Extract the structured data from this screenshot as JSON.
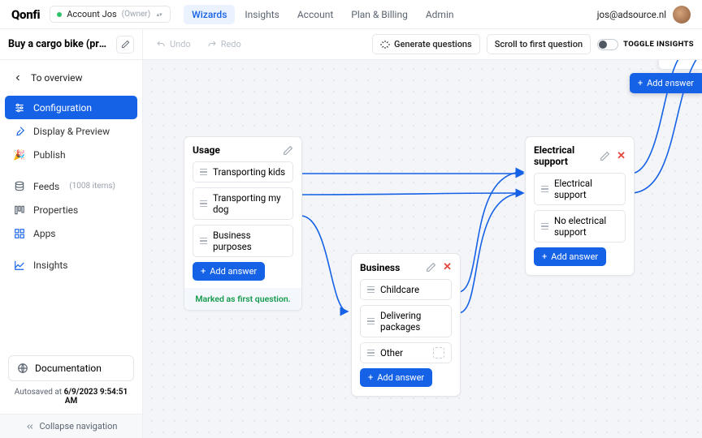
{
  "brand": "Qonfi",
  "account": {
    "name": "Account Jos",
    "role": "(Owner)"
  },
  "topnav": [
    "Wizards",
    "Insights",
    "Account",
    "Plan & Billing",
    "Admin"
  ],
  "topnav_active": 0,
  "user_email": "jos@adsource.nl",
  "page_title": "Buy a cargo bike (produc…",
  "toolbar": {
    "undo": "Undo",
    "redo": "Redo",
    "generate": "Generate questions",
    "scroll": "Scroll to first question",
    "toggle": "TOGGLE INSIGHTS"
  },
  "sidebar": {
    "to_overview": "To overview",
    "items": [
      {
        "label": "Configuration"
      },
      {
        "label": "Display & Preview"
      },
      {
        "label": "Publish"
      },
      {
        "label": "Feeds",
        "count": "(1008 items)"
      },
      {
        "label": "Properties"
      },
      {
        "label": "Apps"
      },
      {
        "label": "Insights"
      }
    ],
    "active": 0,
    "documentation": "Documentation",
    "autosaved_prefix": "Autosaved at ",
    "autosaved_time": "6/9/2023 9:54:51 AM",
    "collapse": "Collapse navigation"
  },
  "canvas": {
    "add_answer": "Add answer",
    "cards": {
      "usage": {
        "title": "Usage",
        "answers": [
          "Transporting kids",
          "Transporting my dog",
          "Business purposes"
        ],
        "add": "Add answer",
        "marked": "Marked as first question."
      },
      "business": {
        "title": "Business",
        "answers": [
          "Childcare",
          "Delivering packages",
          "Other"
        ],
        "add": "Add answer"
      },
      "electrical": {
        "title": "Electrical support",
        "answers": [
          "Electrical support",
          "No electrical support"
        ],
        "add": "Add answer"
      }
    }
  }
}
